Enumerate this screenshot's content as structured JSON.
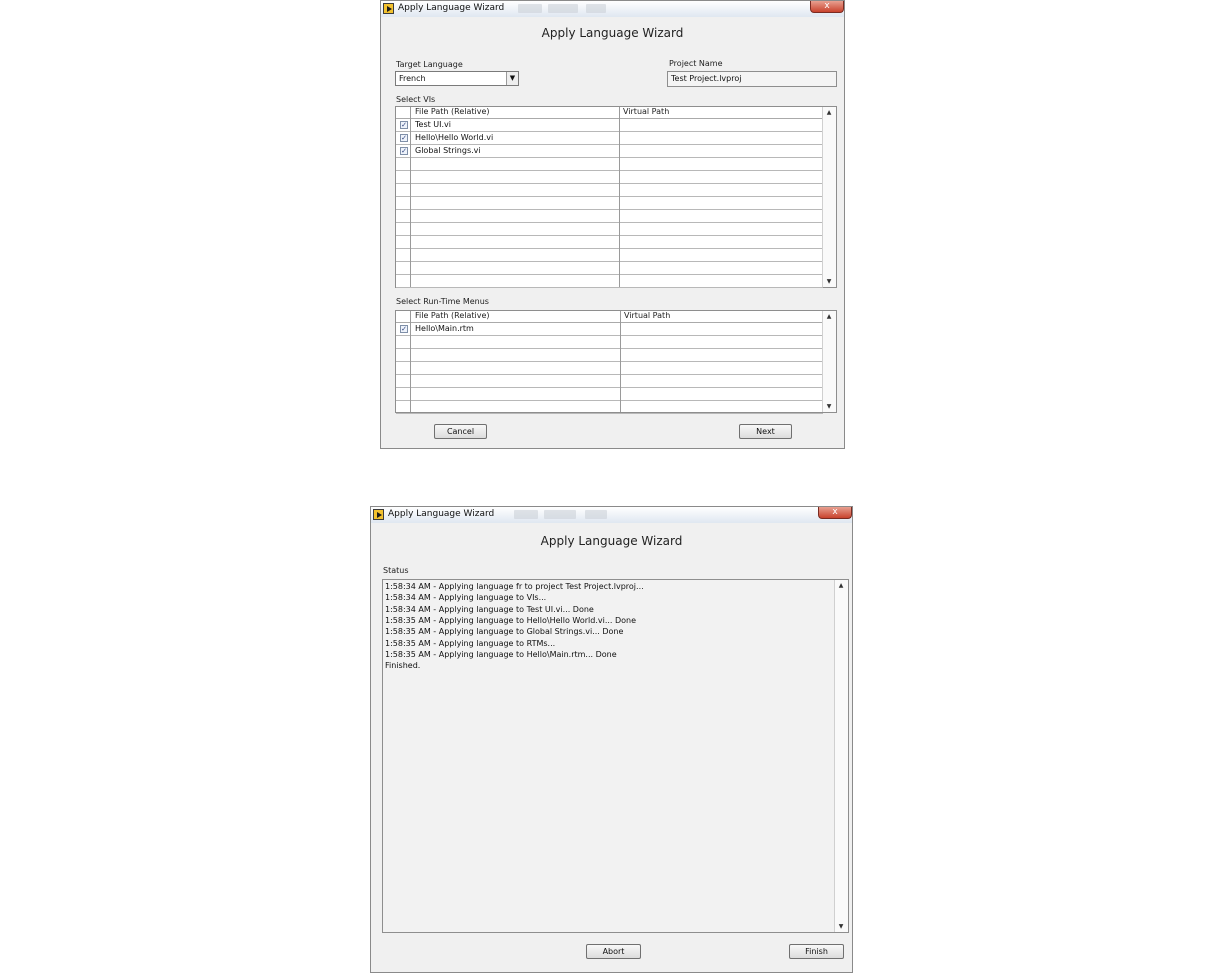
{
  "window1": {
    "title": "Apply Language Wizard",
    "heading": "Apply Language Wizard",
    "target_language_label": "Target Language",
    "target_language_value": "French",
    "project_name_label": "Project Name",
    "project_name_value": "Test Project.lvproj",
    "select_vis_label": "Select VIs",
    "vis_columns": [
      "File Path (Relative)",
      "Virtual Path"
    ],
    "vis_rows": [
      {
        "checked": true,
        "path": "Test UI.vi",
        "virtual": ""
      },
      {
        "checked": true,
        "path": "Hello\\Hello World.vi",
        "virtual": ""
      },
      {
        "checked": true,
        "path": "Global Strings.vi",
        "virtual": ""
      }
    ],
    "select_rtm_label": "Select Run-Time Menus",
    "rtm_columns": [
      "File Path (Relative)",
      "Virtual Path"
    ],
    "rtm_rows": [
      {
        "checked": true,
        "path": "Hello\\Main.rtm",
        "virtual": ""
      }
    ],
    "cancel_label": "Cancel",
    "next_label": "Next"
  },
  "window2": {
    "title": "Apply Language Wizard",
    "heading": "Apply Language Wizard",
    "status_label": "Status",
    "log_lines": [
      "1:58:34 AM - Applying language fr to project Test Project.lvproj...",
      "1:58:34 AM - Applying language to VIs...",
      "1:58:34 AM - Applying language to Test UI.vi... Done",
      "1:58:35 AM - Applying language to Hello\\Hello World.vi... Done",
      "1:58:35 AM - Applying language to Global Strings.vi... Done",
      "1:58:35 AM - Applying language to RTMs...",
      "1:58:35 AM - Applying language to Hello\\Main.rtm... Done",
      "Finished."
    ],
    "abort_label": "Abort",
    "finish_label": "Finish"
  },
  "close_glyph": "x",
  "check_glyph": "✓",
  "scroll_up_glyph": "▲",
  "scroll_down_glyph": "▼",
  "dropdown_glyph": "▼"
}
